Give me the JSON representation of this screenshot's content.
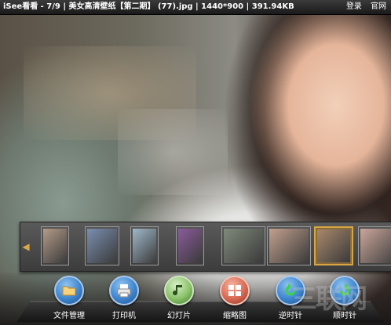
{
  "titlebar": {
    "title": "iSee看看 - 7/9 | 美女高清壁纸【第二期】 (77).jpg | 1440*900 | 391.94KB",
    "login": "登录",
    "official_site": "官网"
  },
  "thumbnails": [
    {
      "name": "thumbnail-1",
      "color": "#b49b88",
      "selected": false
    },
    {
      "name": "thumbnail-2",
      "color": "#7a8eb0",
      "selected": false
    },
    {
      "name": "thumbnail-3",
      "color": "#9fb8c9",
      "selected": false
    },
    {
      "name": "thumbnail-4",
      "color": "#8a5c9a",
      "selected": false
    },
    {
      "name": "thumbnail-5",
      "color": "#7f8a7a",
      "selected": false
    },
    {
      "name": "thumbnail-6",
      "color": "#c2a08e",
      "selected": false
    },
    {
      "name": "thumbnail-7",
      "color": "#a8886c",
      "selected": true
    },
    {
      "name": "thumbnail-8",
      "color": "#caa69a",
      "selected": false
    }
  ],
  "toolbar": {
    "file_manager": "文件管理",
    "printer": "打印机",
    "slideshow": "幻灯片",
    "thumbnail_view": "缩略图",
    "rotate_ccw": "逆时针",
    "rotate_cw": "顺时针"
  },
  "icons": {
    "prev": "chevron-left-icon",
    "file_manager": "folder-icon",
    "printer": "printer-icon",
    "slideshow": "music-note-icon",
    "thumbnail_view": "grid-icon",
    "rotate_ccw": "rotate-ccw-icon",
    "rotate_cw": "rotate-cw-icon"
  },
  "watermark": "三联网"
}
